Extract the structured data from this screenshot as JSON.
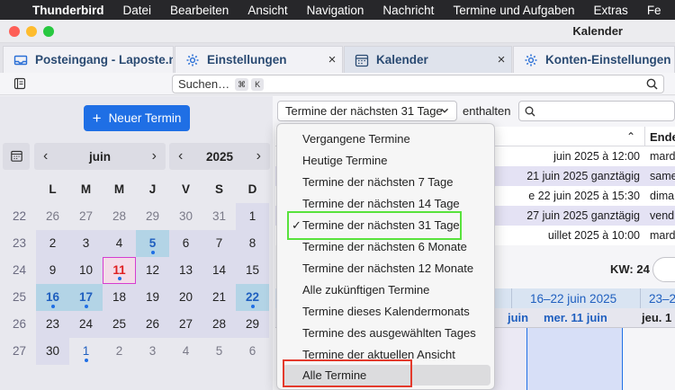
{
  "menubar": {
    "app": "Thunderbird",
    "items": [
      "Datei",
      "Bearbeiten",
      "Ansicht",
      "Navigation",
      "Nachricht",
      "Termine und Aufgaben",
      "Extras",
      "Fe"
    ]
  },
  "window": {
    "title": "Kalender"
  },
  "tabs": [
    {
      "label": "Posteingang - Laposte.net",
      "icon": "inbox-icon",
      "close": "×"
    },
    {
      "label": "Einstellungen",
      "icon": "gear-icon",
      "close": "×"
    },
    {
      "label": "Kalender",
      "icon": "calendar-icon",
      "close": "×"
    },
    {
      "label": "Konten-Einstellungen",
      "icon": "account-settings-icon",
      "close": ""
    }
  ],
  "search": {
    "placeholder": "Suchen…",
    "kbd1": "⌘",
    "kbd2": "K"
  },
  "sidebar": {
    "new_event": "Neuer Termin",
    "month": "juin",
    "year": "2025",
    "weekdays": [
      "L",
      "M",
      "M",
      "J",
      "V",
      "S",
      "D"
    ],
    "weeks": [
      {
        "wk": "22",
        "days": [
          "26",
          "27",
          "28",
          "29",
          "30",
          "31",
          "1"
        ]
      },
      {
        "wk": "23",
        "days": [
          "2",
          "3",
          "4",
          "5",
          "6",
          "7",
          "8"
        ]
      },
      {
        "wk": "24",
        "days": [
          "9",
          "10",
          "11",
          "12",
          "13",
          "14",
          "15"
        ]
      },
      {
        "wk": "25",
        "days": [
          "16",
          "17",
          "18",
          "19",
          "20",
          "21",
          "22"
        ]
      },
      {
        "wk": "26",
        "days": [
          "23",
          "24",
          "25",
          "26",
          "27",
          "28",
          "29"
        ]
      },
      {
        "wk": "27",
        "days": [
          "30",
          "1",
          "2",
          "3",
          "4",
          "5",
          "6"
        ]
      }
    ]
  },
  "filter": {
    "selected": "Termine der nächsten 31 Tage",
    "contains": "enthalten"
  },
  "dropdown": {
    "items": [
      "Vergangene Termine",
      "Heutige Termine",
      "Termine der nächsten 7 Tage",
      "Termine der nächsten 14 Tage",
      "Termine der nächsten 31 Tage",
      "Termine der nächsten 6 Monate",
      "Termine der nächsten 12 Monate",
      "Alle zukünftigen Termine",
      "Termine dieses Kalendermonats",
      "Termine des ausgewählten Tages",
      "Termine der aktuellen Ansicht",
      "Alle Termine"
    ],
    "check": "✓"
  },
  "event_list": {
    "end_header": "Ende",
    "rows": [
      {
        "start": "juin 2025 à 12:00",
        "end": "mardi"
      },
      {
        "start": "21 juin 2025 ganztägig",
        "end": "samed"
      },
      {
        "start": "e 22 juin 2025 à 15:30",
        "end": "diman"
      },
      {
        "start": "27 juin 2025 ganztägig",
        "end": "vendr"
      },
      {
        "start": "uillet 2025 à 10:00",
        "end": "mardi"
      }
    ]
  },
  "week_view": {
    "kw_label": "KW: 24",
    "range1": "16–22 juin 2025",
    "range2": "23–2",
    "day_today": "mer. 11 juin",
    "day_next": "jeu. 1",
    "day_prev": "juin"
  }
}
